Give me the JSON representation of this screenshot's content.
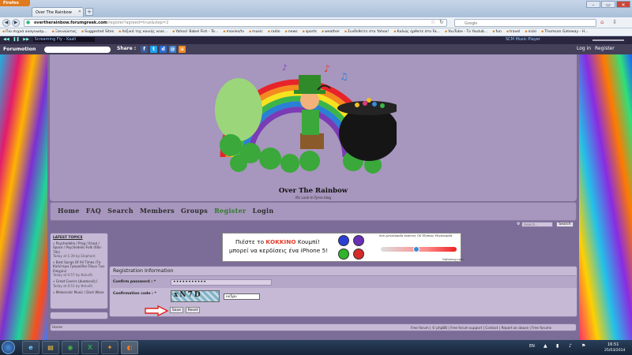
{
  "browser": {
    "app_button": "Firefox",
    "tab_title": "Over The Rainbow",
    "url_host": "overtherainbow.forumgreek.com",
    "url_path": "/register?agreed=true&step=2",
    "search_engine": "Google",
    "search_placeholder": "Google",
    "bookmarks": [
      "Πιο συχνά αναγνωσμ...",
      "Ξεκινώντας",
      "Suggested Sites",
      "Λεξικό της κοινής νεοε...",
      "Yahoo! Babel Fish - Te...",
      "movies/tv",
      "music",
      "radio",
      "news",
      "sports",
      "weather",
      "Συνδεθείτε στο Yahoo!",
      "Καλώς ήρθατε στο Fa...",
      "YouTube - Το Youtub...",
      "fun",
      "travel",
      "nicki",
      "Thomson Gateway - H..."
    ]
  },
  "music_bar": {
    "song": "Screaming Fly - Kaali",
    "player_label": "SCM Music Player"
  },
  "forumotion_bar": {
    "logo": "Forumotion",
    "share_label": "Share :",
    "login": "Log in",
    "register": "Register"
  },
  "site": {
    "title": "Over The Rainbow",
    "subtitle": "Ιδε Look-In-Tyme blog",
    "menu": [
      "Home",
      "FAQ",
      "Search",
      "Members",
      "Groups",
      "Register",
      "Login"
    ],
    "search_placeholder": "Search...",
    "search_button": "Search"
  },
  "latest_topics": {
    "title": "LATEST TOPICS",
    "items": [
      {
        "text": "» Psychedelia / Prog / Kraut / Space / Psychedelic-Folk (60s-70s)",
        "date": "Today at 1:39 by Elephant"
      },
      {
        "text": "» Best Songs Of All Times (Τα Καλύτερα Τραγούδια Όλων Των Εποχών)",
        "date": "Today at 0:57 by Φιλινδί"
      },
      {
        "text": "» Great Covers (Διασκευές)",
        "date": "Today at 0:51 by Φιλινδί"
      },
      {
        "text": "» Melancolic Music / Dark Wave"
      }
    ]
  },
  "ad": {
    "line1_pre": "Πιέστε το",
    "line1_red": "ΚΟΚΚΙΝΟ",
    "line1_post": "Κουμπί!",
    "line2": "μπορεί να κερδίσεις ένα iPhone 5!",
    "meter_labels": "Αντι-μεγαλοφυΐα   Ανόητος   ΟΚ   Έξυπνος   Μεγαλοφυΐα",
    "brand": "Gallamay.com",
    "colors": {
      "blue": "#2a3fd6",
      "purple": "#6a2fb5",
      "green": "#2fb52a",
      "red": "#d62a2a"
    }
  },
  "registration": {
    "title": "Registration Information",
    "password_label": "Confirm password : *",
    "password_value": "•••••••••••",
    "code_label": "Confirmation code : *",
    "captcha_text": "xN7D",
    "code_value": "υυ5ρυ",
    "save": "Save",
    "reset": "Reset"
  },
  "footer": {
    "home": "Home",
    "links": "Free forum | © phpBB | Free forum support | Contact | Report an abuse | Free forums"
  },
  "taskbar": {
    "lang": "EN",
    "time": "16:51",
    "date": "25/03/2014"
  },
  "colors": {
    "page_bg": "#7b6c98",
    "panel_bg": "#c5b9d6",
    "header_bg": "#a796bd"
  }
}
